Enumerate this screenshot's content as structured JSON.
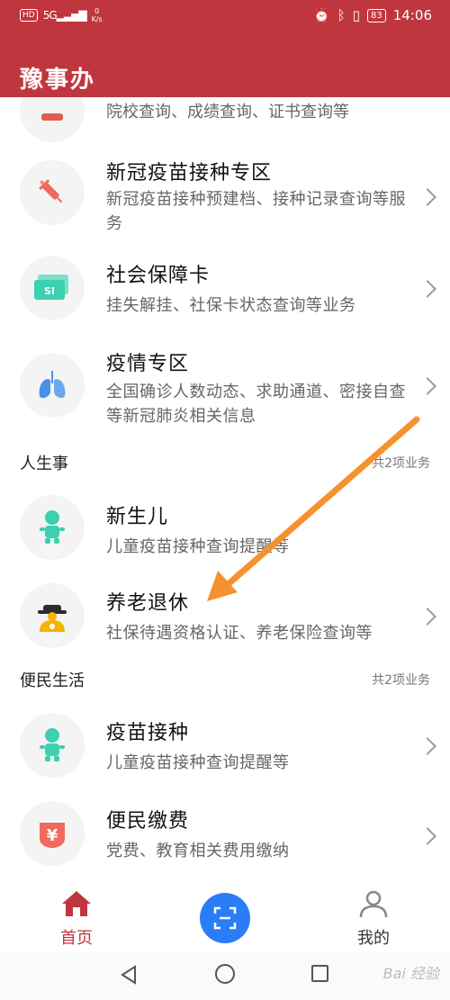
{
  "status_bar": {
    "hd_badge": "HD",
    "signal": "5G",
    "net_speed_value": "0",
    "net_speed_unit": "K/s",
    "battery": "83",
    "time": "14:06"
  },
  "header": {
    "title": "豫事办"
  },
  "partial_item": {
    "desc": "院校查询、成绩查询、证书查询等",
    "icon": "graduation-icon"
  },
  "items_top": [
    {
      "title": "新冠疫苗接种专区",
      "desc": "新冠疫苗接种预建档、接种记录查询等服务",
      "icon": "syringe-icon"
    },
    {
      "title": "社会保障卡",
      "desc": "挂失解挂、社保卡状态查询等业务",
      "icon": "social-security-card-icon",
      "icon_text": "SI"
    },
    {
      "title": "疫情专区",
      "desc": "全国确诊人数动态、求助通道、密接自查等新冠肺炎相关信息",
      "icon": "lungs-icon"
    }
  ],
  "section_life": {
    "name": "人生事",
    "count": "共2项业务"
  },
  "items_life": [
    {
      "title": "新生儿",
      "desc": "儿童疫苗接种查询提醒等",
      "icon": "baby-icon"
    },
    {
      "title": "养老退休",
      "desc": "社保待遇资格认证、养老保险查询等",
      "icon": "elderly-icon"
    }
  ],
  "section_convenience": {
    "name": "便民生活",
    "count": "共2项业务"
  },
  "items_convenience": [
    {
      "title": "疫苗接种",
      "desc": "儿童疫苗接种查询提醒等",
      "icon": "baby-icon"
    },
    {
      "title": "便民缴费",
      "desc": "党费、教育相关费用缴纳",
      "icon": "yuan-icon",
      "icon_text": "¥"
    }
  ],
  "bottom_nav": {
    "home_label": "首页",
    "mine_label": "我的"
  },
  "watermark": "Bai 经验",
  "colors": {
    "brand_red": "#c0363f",
    "scan_blue": "#2a7df6",
    "annotation_orange": "#f5922f",
    "teal": "#3ccfb0",
    "yellow": "#f5b400"
  }
}
